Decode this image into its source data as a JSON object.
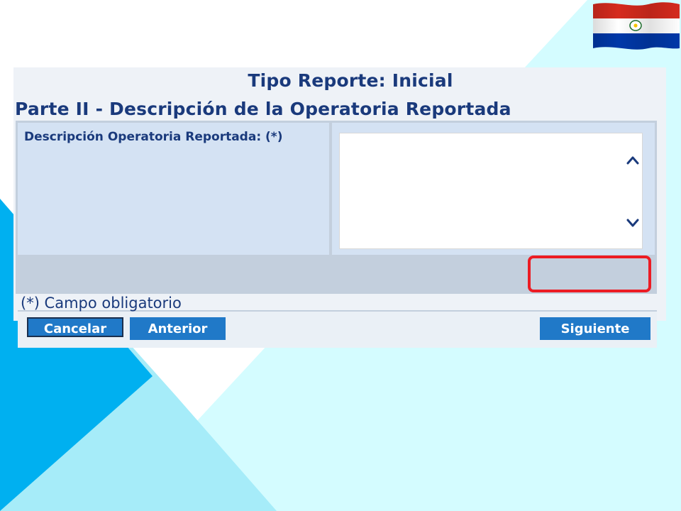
{
  "header": {
    "report_type": "Tipo Reporte: Inicial",
    "section_title": "Parte II - Descripción de la Operatoria Reportada"
  },
  "form": {
    "field_label": "Descripción Operatoria Reportada: (*)",
    "field_value": "",
    "required_note": "(*) Campo obligatorio"
  },
  "buttons": {
    "cancel": "Cancelar",
    "previous": "Anterior",
    "next": "Siguiente"
  },
  "icons": {
    "flag": "paraguay-flag-icon",
    "scroll_up": "chevron-up-icon",
    "scroll_down": "chevron-down-icon"
  },
  "colors": {
    "title_text": "#1a3a7c",
    "button": "#2079c8",
    "highlight": "#ec1c24",
    "panel_bg": "#eef2f7",
    "field_bg": "#d4e2f3"
  }
}
